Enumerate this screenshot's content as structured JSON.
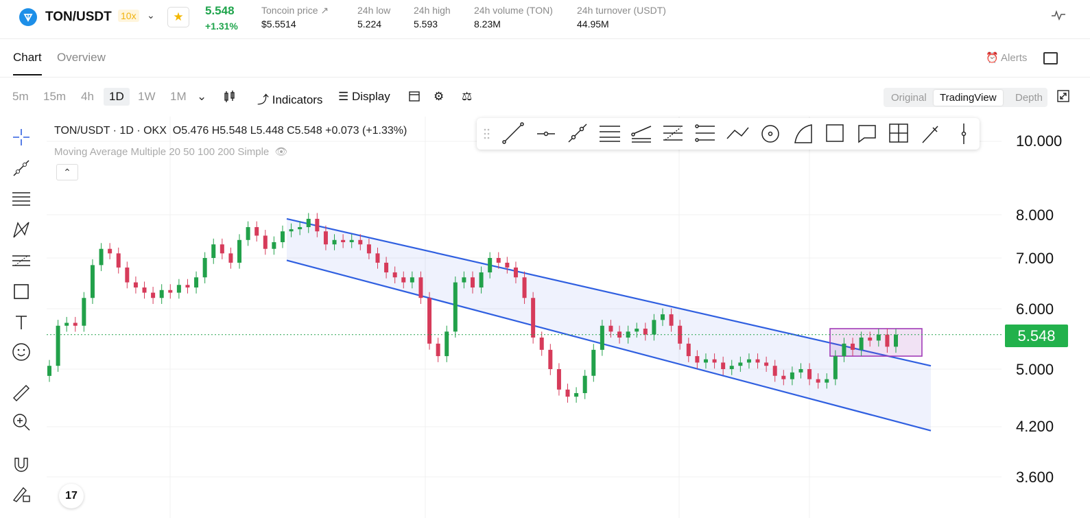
{
  "header": {
    "pair": "TON/USDT",
    "leverage": "10x",
    "last_price": "5.548",
    "change": "+1.31%",
    "stats": [
      {
        "label": "Toncoin price",
        "value": "$5.5514"
      },
      {
        "label": "24h low",
        "value": "5.224"
      },
      {
        "label": "24h high",
        "value": "5.593"
      },
      {
        "label": "24h volume (TON)",
        "value": "8.23M"
      },
      {
        "label": "24h turnover (USDT)",
        "value": "44.95M"
      }
    ]
  },
  "tabs": {
    "chart": "Chart",
    "overview": "Overview",
    "alerts": "Alerts"
  },
  "toolbar": {
    "timeframes": [
      "5m",
      "15m",
      "4h",
      "1D",
      "1W",
      "1M"
    ],
    "indicators": "Indicators",
    "display": "Display",
    "views": [
      "Original",
      "TradingView",
      "Depth"
    ]
  },
  "legend": {
    "title": "TON/USDT · 1D · OKX",
    "ohlc": "O5.476  H5.548  L5.448  C5.548  +0.073 (+1.33%)",
    "ma": "Moving Average Multiple 20 50 100 200 Simple"
  },
  "colors": {
    "up": "#22a14a",
    "down": "#d63b5a",
    "channel": "#2f5fe0",
    "box": "#a13bb7"
  },
  "chart_data": {
    "type": "candlestick",
    "y_ticks": [
      10.0,
      8.0,
      7.0,
      6.0,
      5.0,
      4.2,
      3.6
    ],
    "y_tick_labels": [
      "10.000",
      "8.000",
      "7.000",
      "6.000",
      "5.000",
      "4.200",
      "3.600"
    ],
    "scale": "log",
    "current_price": "5.548",
    "series_approx_closes": [
      5.05,
      5.7,
      5.75,
      5.7,
      6.2,
      6.85,
      7.2,
      7.1,
      6.8,
      6.5,
      6.4,
      6.3,
      6.2,
      6.35,
      6.3,
      6.45,
      6.4,
      6.6,
      7.0,
      7.3,
      7.1,
      6.9,
      7.4,
      7.7,
      7.5,
      7.2,
      7.35,
      7.6,
      7.65,
      7.7,
      7.9,
      7.6,
      7.3,
      7.4,
      7.35,
      7.4,
      7.3,
      7.1,
      6.9,
      6.7,
      6.6,
      6.5,
      6.6,
      6.2,
      5.4,
      5.2,
      5.6,
      6.5,
      6.6,
      6.4,
      6.7,
      7.0,
      6.9,
      6.8,
      6.6,
      6.2,
      5.5,
      5.3,
      5.0,
      4.7,
      4.6,
      4.65,
      4.9,
      5.3,
      5.7,
      5.6,
      5.5,
      5.6,
      5.65,
      5.55,
      5.8,
      5.9,
      5.7,
      5.4,
      5.2,
      5.1,
      5.15,
      5.1,
      5.0,
      5.05,
      5.1,
      5.15,
      5.1,
      5.05,
      4.9,
      4.85,
      4.95,
      5.0,
      4.85,
      4.8,
      4.85,
      5.2,
      5.4,
      5.3,
      5.5,
      5.45,
      5.55,
      5.35,
      5.548
    ],
    "channel_upper": [
      [
        7.9,
        0
      ],
      [
        5.05,
        1
      ]
    ],
    "channel_lower": [
      [
        6.95,
        0
      ],
      [
        4.15,
        1
      ]
    ],
    "highlight_box": {
      "low": 5.2,
      "high": 5.65
    }
  }
}
